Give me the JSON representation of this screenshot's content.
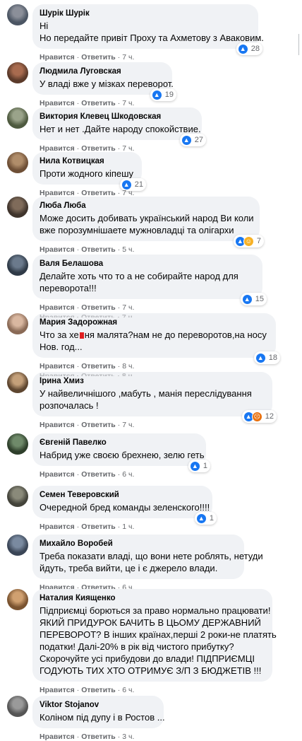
{
  "ui": {
    "like_label": "Нравится",
    "reply_label": "Ответить",
    "separator": "·"
  },
  "comments": [
    {
      "author": "Шурік Шурік",
      "lines": [
        "Ні",
        "Но передайте привіт Проху та Ахметову з Аваковим."
      ],
      "time": "7 ч.",
      "reactions": [
        "like"
      ],
      "count": "28"
    },
    {
      "author": "Людмила Луговская",
      "lines": [
        "У владі вже у мізках переворот."
      ],
      "time": "7 ч.",
      "reactions": [
        "like"
      ],
      "count": "19"
    },
    {
      "author": "Виктория Клевец Шкодовская",
      "lines": [
        "Нет и нет .Дайте народу спокойствие."
      ],
      "time": "7 ч.",
      "reactions": [
        "like"
      ],
      "count": "27"
    },
    {
      "author": "Нила Котвицкая",
      "lines": [
        "Проти жодного кіпешу"
      ],
      "time": "7 ч.",
      "reactions": [
        "like"
      ],
      "count": "21"
    },
    {
      "author": "Люба Люба",
      "lines": [
        "Може досить добивать український народ Ви коли",
        "вже порозумнішаете мужновладці та олігархи"
      ],
      "time": "5 ч.",
      "reactions": [
        "like",
        "haha"
      ],
      "count": "7"
    },
    {
      "author": "Валя Белашова",
      "lines": [
        "Делайте хоть что то а не собирайте народ для",
        "переворота!!!"
      ],
      "time": "7 ч.",
      "reactions": [
        "like"
      ],
      "count": "15"
    },
    {
      "author": "Мария Задорожная",
      "lines": [
        "Что за хе  ня малята?нам не до переворотов,на носу",
        "Нов. год..."
      ],
      "time": "8 ч.",
      "reactions": [
        "like"
      ],
      "count": "18"
    },
    {
      "author": "Ірина Хмиз",
      "lines": [
        "У найвеличнішого ,мабуть , манія переслідування",
        "розпочалась !"
      ],
      "time": "7 ч.",
      "reactions": [
        "like",
        "angry"
      ],
      "count": "12"
    },
    {
      "author": "Євгеній Павелко",
      "lines": [
        "Набрид уже своєю брехнею, зелю геть"
      ],
      "time": "6 ч.",
      "reactions": [
        "like"
      ],
      "count": "1"
    },
    {
      "author": "Семен Теверовский",
      "lines": [
        "Очередной бред команды зеленского!!!!"
      ],
      "time": "1 ч.",
      "reactions": [
        "like"
      ],
      "count": "1"
    },
    {
      "author": "Михайло Воробей",
      "lines": [
        "Треба показати владі, що вони нете роблять, нетуди",
        "йдуть, треба вийти, це і є джерело влади."
      ],
      "time": "6 ч.",
      "reactions": [],
      "count": ""
    },
    {
      "author": "Наталия Киященко",
      "lines": [
        "Підприємці борються за право нормально працювати!",
        "ЯКИЙ ПРИДУРОК БАЧИТЬ В ЦЬОМУ ДЕРЖАВНИЙ",
        "ПЕРЕВОРОТ? В інших країнах,перші 2 роки-не платять",
        "податки! Далі-20% в рік від чистого прибутку?",
        "Скорочуйте усі прибудови до влади! ПІДПРИЄМЦІ",
        "ГОДУЮТЬ ТИХ ХТО ОТРИМУЄ З/П З БЮДЖЕТІВ !!!"
      ],
      "time": "6 ч.",
      "reactions": [],
      "count": ""
    },
    {
      "author": "Viktor Stojanov",
      "lines": [
        "Коліном під дупу і в Ростов ..."
      ],
      "time": "3 ч.",
      "reactions": [],
      "count": ""
    }
  ],
  "ghost_rows": [
    {
      "after": 5,
      "text": "Нравится · Ответить · 7 ч."
    },
    {
      "after": 6,
      "text": "Нравится · Ответить · 8 ч."
    }
  ],
  "colors": {
    "bubble": "#f0f2f5",
    "text": "#050505",
    "meta": "#65676b",
    "like": "#1877f2",
    "haha": "#f7b125",
    "angry": "#e9710f"
  },
  "icons": {
    "like": "thumbs-up-icon",
    "haha": "laughing-face-icon",
    "angry": "angry-face-icon"
  }
}
